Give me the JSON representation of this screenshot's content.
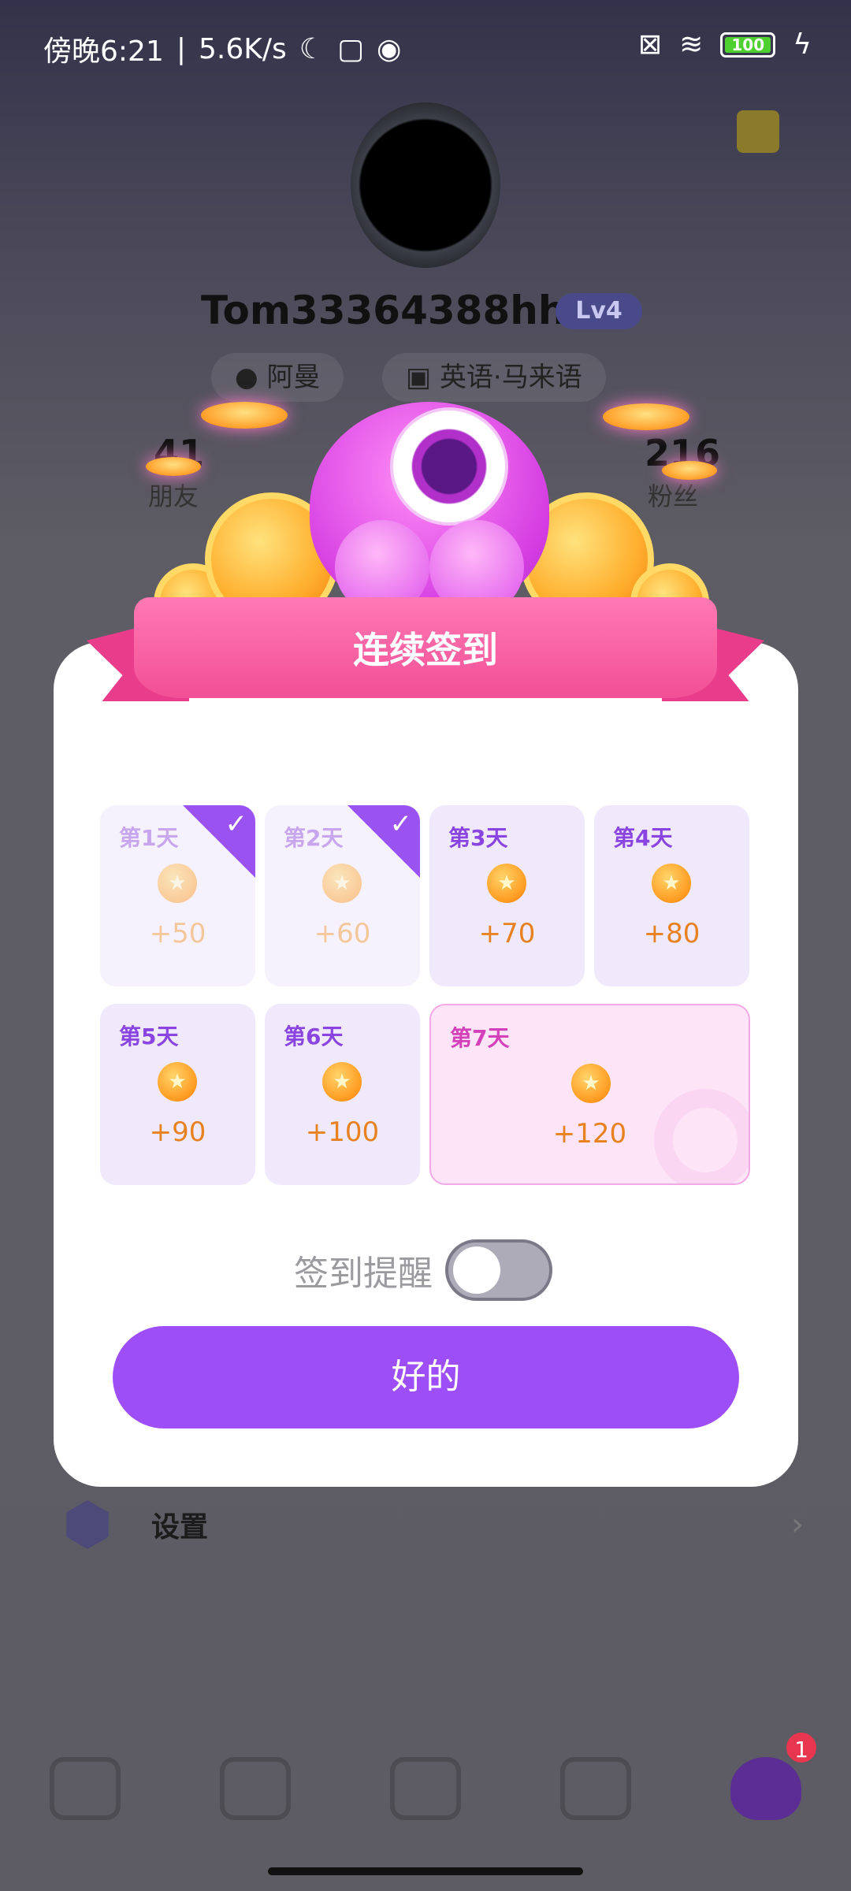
{
  "status_bar": {
    "time_label": "傍晚6:21",
    "net_speed": "5.6K/s",
    "battery_level": "100"
  },
  "profile": {
    "username": "Tom33364388hhh",
    "level": "Lv4",
    "country": "阿曼",
    "languages": "英语·马来语",
    "friends_count": "41",
    "friends_label": "朋友",
    "fans_count": "216",
    "fans_label": "粉丝"
  },
  "menu": {
    "settings_label": "设置"
  },
  "bottom_nav": {
    "badge_count": "1"
  },
  "dialog": {
    "title": "连续签到",
    "days": [
      {
        "label": "第1天",
        "amount": "+50",
        "claimed": true
      },
      {
        "label": "第2天",
        "amount": "+60",
        "claimed": true
      },
      {
        "label": "第3天",
        "amount": "+70",
        "claimed": false
      },
      {
        "label": "第4天",
        "amount": "+80",
        "claimed": false
      },
      {
        "label": "第5天",
        "amount": "+90",
        "claimed": false
      },
      {
        "label": "第6天",
        "amount": "+100",
        "claimed": false
      },
      {
        "label": "第7天",
        "amount": "+120",
        "claimed": false
      }
    ],
    "reminder_label": "签到提醒",
    "reminder_enabled": false,
    "ok_button": "好的"
  },
  "colors": {
    "accent": "#9d4ef7",
    "ribbon": "#f24f96",
    "coin": "#ff9a1f"
  }
}
